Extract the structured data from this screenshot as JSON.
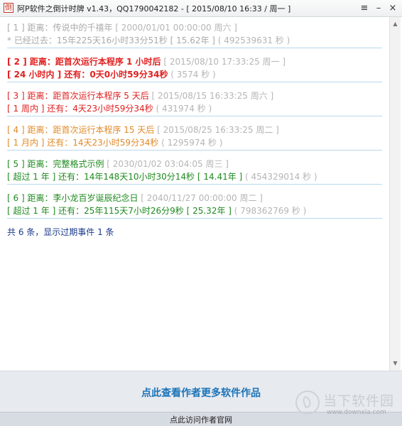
{
  "window": {
    "icon_glyph": "倒",
    "title": "阿P软件之倒计时牌 v1.43，QQ1790042182 - [ 2015/08/10 16:33 / 周一 ]",
    "menu_glyph": "≡",
    "minimize_glyph": "–",
    "close_glyph": "×"
  },
  "events": [
    {
      "color": "gray",
      "l1": [
        {
          "t": "[ 1 ] 距离：传说中的千禧年"
        },
        {
          "t": "  [ 2000/01/01 00:00:00 周六 ]",
          "g": true
        }
      ],
      "l2": [
        {
          "t": "* 已经过去：15年225天16小时33分51秒  [ 15.62年 ]"
        },
        {
          "t": "  ( 492539631 秒 )",
          "g": true
        }
      ]
    },
    {
      "color": "red",
      "bold": true,
      "l1": [
        {
          "t": "[ 2 ] 距离：距首次运行本程序 1 小时后"
        },
        {
          "t": "  [ 2015/08/10 17:33:25 周一 ]",
          "g": true
        }
      ],
      "l2": [
        {
          "t": "[ 24 小时内 ] 还有：0天0小时59分34秒"
        },
        {
          "t": "  ( 3574 秒 )",
          "g": true
        }
      ]
    },
    {
      "color": "red",
      "l1": [
        {
          "t": "[ 3 ] 距离：距首次运行本程序 5 天后"
        },
        {
          "t": "  [ 2015/08/15 16:33:25 周六 ]",
          "g": true
        }
      ],
      "l2": [
        {
          "t": "[ 1 周内 ] 还有：4天23小时59分34秒"
        },
        {
          "t": "  ( 431974 秒 )",
          "g": true
        }
      ]
    },
    {
      "color": "orange",
      "l1": [
        {
          "t": "[ 4 ] 距离：距首次运行本程序 15 天后"
        },
        {
          "t": "  [ 2015/08/25 16:33:25 周二 ]",
          "g": true
        }
      ],
      "l2": [
        {
          "t": "[ 1 月内 ] 还有：14天23小时59分34秒"
        },
        {
          "t": "  ( 1295974 秒 )",
          "g": true
        }
      ]
    },
    {
      "color": "green",
      "l1": [
        {
          "t": "[ 5 ] 距离：完整格式示例"
        },
        {
          "t": "  [ 2030/01/02 03:04:05 周三 ]",
          "g": true
        }
      ],
      "l2": [
        {
          "t": "[ 超过 1 年 ] 还有：14年148天10小时30分14秒  [ 14.41年 ]"
        },
        {
          "t": "  ( 454329014 秒 )",
          "g": true
        }
      ]
    },
    {
      "color": "green",
      "l1": [
        {
          "t": "[ 6 ] 距离：李小龙百岁诞辰纪念日"
        },
        {
          "t": "  [ 2040/11/27 00:00:00 周二 ]",
          "g": true
        }
      ],
      "l2": [
        {
          "t": "[ 超过 1 年 ] 还有：25年115天7小时26分9秒  [ 25.32年 ]"
        },
        {
          "t": "  ( 798362769 秒 )",
          "g": true
        }
      ]
    }
  ],
  "summary": "共 6 条，显示过期事件 1 条",
  "scrollbar": {
    "up_glyph": "▲",
    "down_glyph": "▼"
  },
  "footer": {
    "main_link": "点此查看作者更多软件作品",
    "site_link": "点此访问作者官网"
  },
  "watermark": {
    "text": "当下软件园",
    "url": "www.downxia.com"
  },
  "colors": {
    "gray": "#aaaaaa",
    "red": "#e02020",
    "orange": "#e08a2a",
    "green": "#1e8a1e",
    "navy": "#1a3a8a",
    "link": "#1a73b8"
  }
}
